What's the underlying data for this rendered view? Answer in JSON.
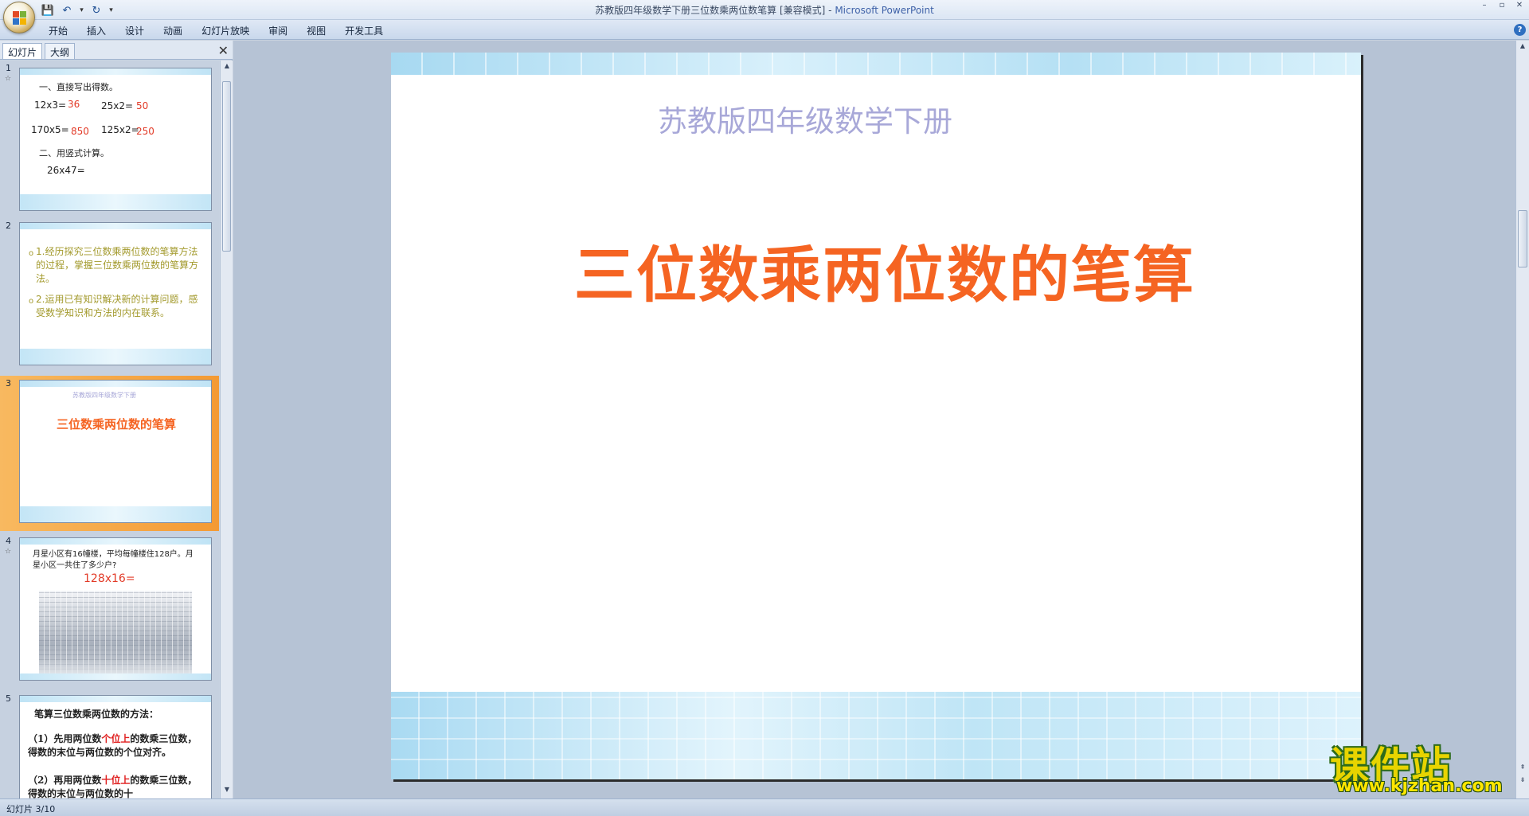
{
  "window": {
    "title_doc": "苏教版四年级数学下册三位数乘两位数笔算 [兼容模式] - ",
    "title_app": "Microsoft PowerPoint",
    "controls": [
      "–",
      "▫",
      "✕"
    ]
  },
  "qat": {
    "save": "💾",
    "undo": "↶",
    "undo_drop": "▾",
    "redo": "↻",
    "customize": "▾"
  },
  "ribbon": {
    "tabs": [
      "开始",
      "插入",
      "设计",
      "动画",
      "幻灯片放映",
      "审阅",
      "视图",
      "开发工具"
    ],
    "help": "?"
  },
  "pane": {
    "tab_slides": "幻灯片",
    "tab_outline": "大纲",
    "close": "✕"
  },
  "thumbnails": [
    {
      "num": "1",
      "star": "☆",
      "heading1": "一、直接写出得数。",
      "row1_a": "12x3=",
      "row1_a_ans": "36",
      "row1_b": "25x2=",
      "row1_b_ans": "50",
      "row2_a": "170x5=",
      "row2_a_ans": "850",
      "row2_b": "125x2=",
      "row2_b_ans": "250",
      "heading2": "二、用竖式计算。",
      "calc": "26x47="
    },
    {
      "num": "2",
      "bullet": "o",
      "goal1": "1.经历探究三位数乘两位数的笔算方法的过程，掌握三位数乘两位数的笔算方法。",
      "goal2": "2.运用已有知识解决新的计算问题，感受数学知识和方法的内在联系。"
    },
    {
      "num": "3",
      "subtitle": "苏教版四年级数学下册",
      "title": "三位数乘两位数的笔算"
    },
    {
      "num": "4",
      "star": "☆",
      "problem": "月星小区有16幢楼，平均每幢楼住128户。月星小区一共住了多少户?",
      "expr": "128x16="
    },
    {
      "num": "5",
      "heading": "笔算三位数乘两位数的方法：",
      "step1_a": "（1）先用两位数",
      "step1_red": "个位上",
      "step1_b": "的数乘三位数，得数的末位与两位数的个位对齐。",
      "step2_a": "（2）再用两位数",
      "step2_red": "十位上",
      "step2_b": "的数乘三位数，得数的末位与两位数的十"
    }
  ],
  "slide": {
    "subtitle": "苏教版四年级数学下册",
    "title": "三位数乘两位数的笔算"
  },
  "watermark": {
    "brand": "课件站",
    "url": "www.kjzhan.com"
  },
  "status": {
    "text": "幻灯片 3/10"
  },
  "colors": {
    "title_orange": "#f56422",
    "subtitle_lavender": "#a8a8d8",
    "answer_red": "#e23a27",
    "selected_thumb": "#f49a33"
  }
}
